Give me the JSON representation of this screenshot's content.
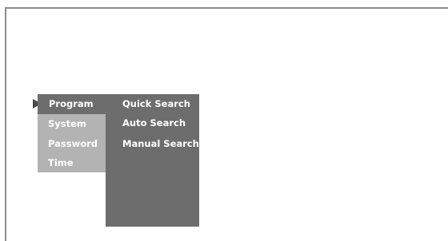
{
  "menu": {
    "items": [
      {
        "label": "Program",
        "selected": true
      },
      {
        "label": "System",
        "selected": false
      },
      {
        "label": "Password",
        "selected": false
      },
      {
        "label": "Time",
        "selected": false
      }
    ]
  },
  "submenu": {
    "items": [
      {
        "label": "Quick Search"
      },
      {
        "label": "Auto Search"
      },
      {
        "label": "Manual Search"
      }
    ]
  },
  "icons": {
    "selector": "triangle-right-icon"
  },
  "colors": {
    "active_bg": "#6d6d6d",
    "inactive_bg": "#b3b3b3",
    "text": "#ffffff",
    "arrow": "#4a4a4a",
    "border": "#8d8d8d",
    "background": "#ffffff"
  }
}
